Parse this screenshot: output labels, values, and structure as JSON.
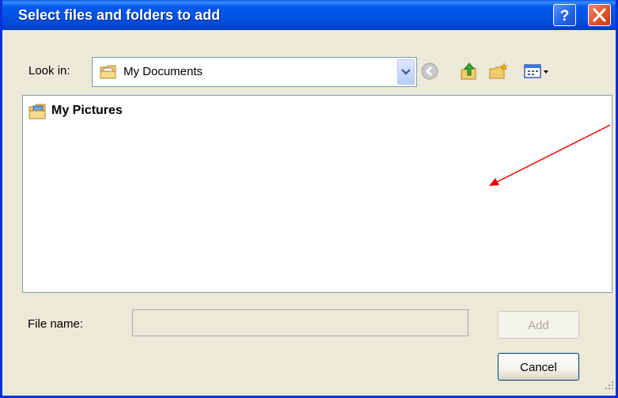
{
  "window": {
    "title": "Select files and folders to add"
  },
  "title_buttons": {
    "help": "?",
    "close": "close"
  },
  "lookin": {
    "label": "Look in:",
    "value": "My Documents"
  },
  "toolbar": {
    "icons": [
      "back-icon",
      "up-folder-icon",
      "new-folder-icon",
      "view-menu-icon"
    ]
  },
  "file_list": {
    "items": [
      {
        "label": "My Pictures",
        "icon": "pictures-folder-icon"
      }
    ]
  },
  "filename": {
    "label": "File name:",
    "value": ""
  },
  "buttons": {
    "add": "Add",
    "cancel": "Cancel"
  },
  "colors": {
    "title_bar": "#0054e3",
    "window_bg": "#ece9d8",
    "annotation_arrow": "#ee0000"
  }
}
